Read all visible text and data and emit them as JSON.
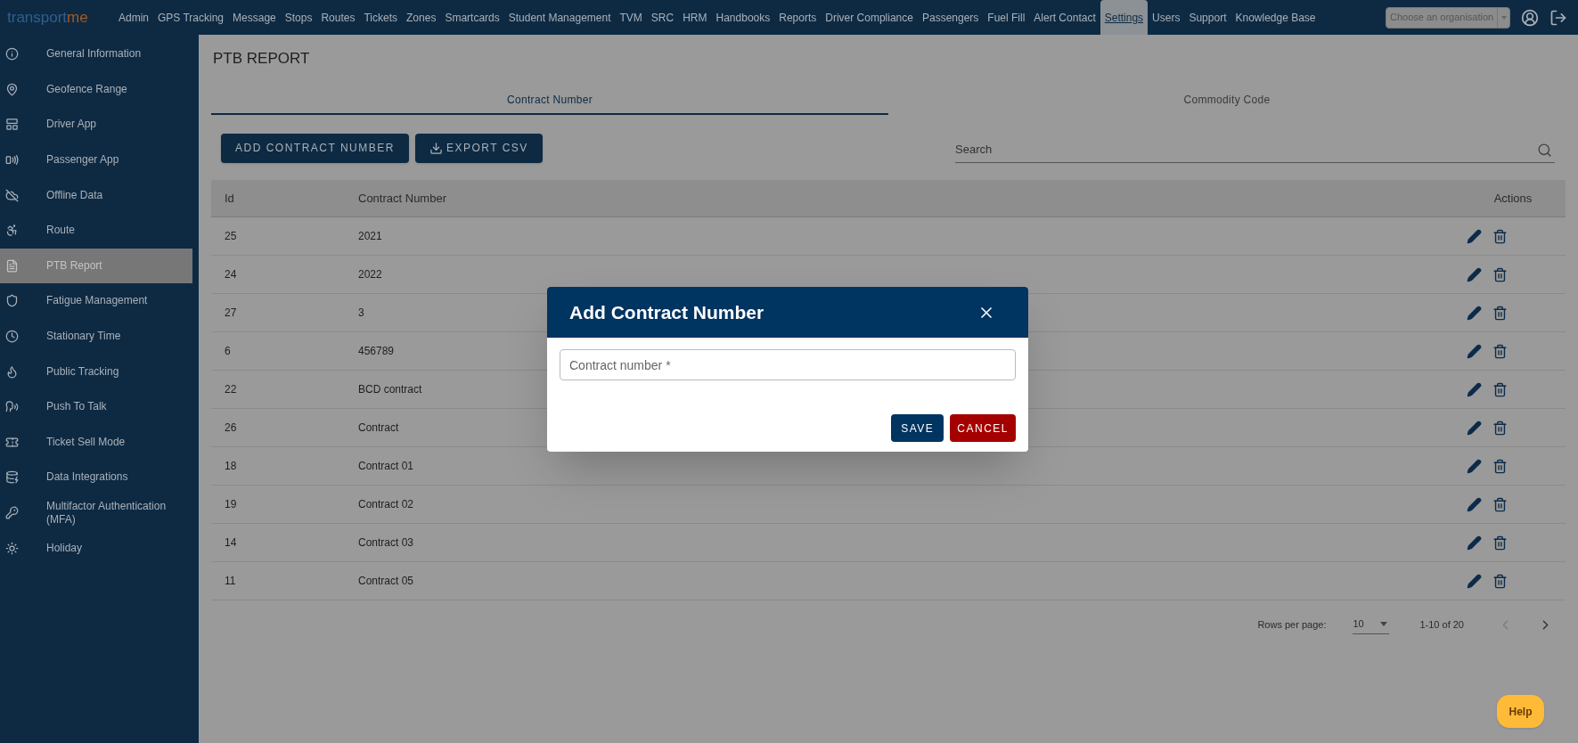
{
  "nav": {
    "logo": {
      "first": "transport",
      "second": "me"
    },
    "items": [
      {
        "label": "Admin",
        "selected": false
      },
      {
        "label": "GPS Tracking",
        "selected": false
      },
      {
        "label": "Message",
        "selected": false
      },
      {
        "label": "Stops",
        "selected": false
      },
      {
        "label": "Routes",
        "selected": false
      },
      {
        "label": "Tickets",
        "selected": false
      },
      {
        "label": "Zones",
        "selected": false
      },
      {
        "label": "Smartcards",
        "selected": false
      },
      {
        "label": "Student Management",
        "selected": false
      },
      {
        "label": "TVM",
        "selected": false
      },
      {
        "label": "SRC",
        "selected": false
      },
      {
        "label": "HRM",
        "selected": false
      },
      {
        "label": "Handbooks",
        "selected": false
      },
      {
        "label": "Reports",
        "selected": false
      },
      {
        "label": "Driver Compliance",
        "selected": false
      },
      {
        "label": "Passengers",
        "selected": false
      },
      {
        "label": "Fuel Fill",
        "selected": false
      },
      {
        "label": "Alert Contact",
        "selected": false
      },
      {
        "label": "Settings",
        "selected": true
      },
      {
        "label": "Users",
        "selected": false
      },
      {
        "label": "Support",
        "selected": false
      },
      {
        "label": "Knowledge Base",
        "selected": false
      }
    ],
    "organisation_select": {
      "placeholder": "Choose an organisation"
    }
  },
  "sidebar": {
    "items": [
      {
        "label": "General Information",
        "selected": false
      },
      {
        "label": "Geofence Range",
        "selected": false
      },
      {
        "label": "Driver App",
        "selected": false
      },
      {
        "label": "Passenger App",
        "selected": false
      },
      {
        "label": "Offline Data",
        "selected": false
      },
      {
        "label": "Route",
        "selected": false
      },
      {
        "label": "PTB Report",
        "selected": true
      },
      {
        "label": "Fatigue Management",
        "selected": false
      },
      {
        "label": "Stationary Time",
        "selected": false
      },
      {
        "label": "Public Tracking",
        "selected": false
      },
      {
        "label": "Push To Talk",
        "selected": false
      },
      {
        "label": "Ticket Sell Mode",
        "selected": false
      },
      {
        "label": "Data Integrations",
        "selected": false
      },
      {
        "label": "Multifactor Authentication (MFA)",
        "selected": false
      },
      {
        "label": "Holiday",
        "selected": false
      }
    ]
  },
  "page_title": "PTB REPORT",
  "tabs": [
    {
      "label": "Contract Number",
      "selected": true
    },
    {
      "label": "Commodity Code",
      "selected": false
    }
  ],
  "actions": {
    "add_button": "ADD CONTRACT NUMBER",
    "export_button": "EXPORT CSV"
  },
  "search": {
    "placeholder": "Search"
  },
  "table": {
    "columns": [
      "Id",
      "Contract Number",
      "Actions"
    ],
    "rows": [
      {
        "id": "25",
        "contract_number": "2021"
      },
      {
        "id": "24",
        "contract_number": "2022"
      },
      {
        "id": "27",
        "contract_number": "3"
      },
      {
        "id": "6",
        "contract_number": "456789"
      },
      {
        "id": "22",
        "contract_number": "BCD contract"
      },
      {
        "id": "26",
        "contract_number": "Contract"
      },
      {
        "id": "18",
        "contract_number": "Contract 01"
      },
      {
        "id": "19",
        "contract_number": "Contract 02"
      },
      {
        "id": "14",
        "contract_number": "Contract 03"
      },
      {
        "id": "11",
        "contract_number": "Contract 05"
      }
    ]
  },
  "pagination": {
    "rows_per_page_label": "Rows per page:",
    "rows_per_page": "10",
    "range": "1-10 of 20",
    "previous_disabled": true,
    "next_disabled": false
  },
  "dialog": {
    "title": "Add Contract Number",
    "field": {
      "placeholder": "Contract number *"
    },
    "save_button": "SAVE",
    "cancel_button": "CANCEL"
  },
  "help_button": "Help"
}
